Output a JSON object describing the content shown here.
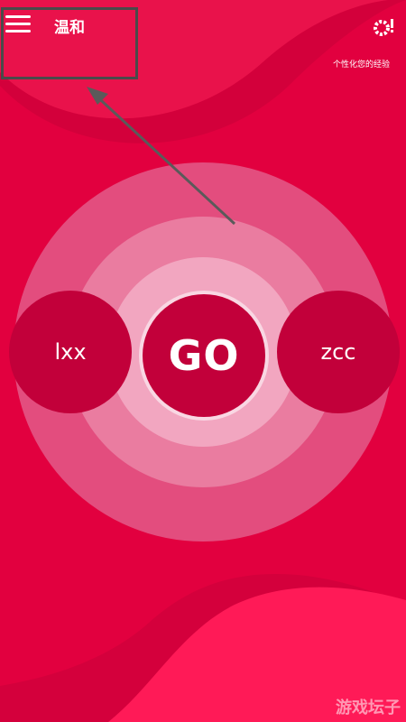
{
  "header": {
    "mode_title": "温和",
    "personalize_text": "个性化您的经验"
  },
  "icons": {
    "menu": "hamburger-menu-icon",
    "settings": "gear-alert-icon"
  },
  "players": {
    "left_name": "lxx",
    "right_name": "zcc"
  },
  "go_label": "GO",
  "watermark": "游戏坛子",
  "colors": {
    "background": "#e2003f",
    "player_circle": "#c2003a",
    "ring_outer": "#e34d7e",
    "ring_mid": "#ea7ca0",
    "ring_inner": "#f2a6c0",
    "highlight_border": "#4a4a4a"
  }
}
